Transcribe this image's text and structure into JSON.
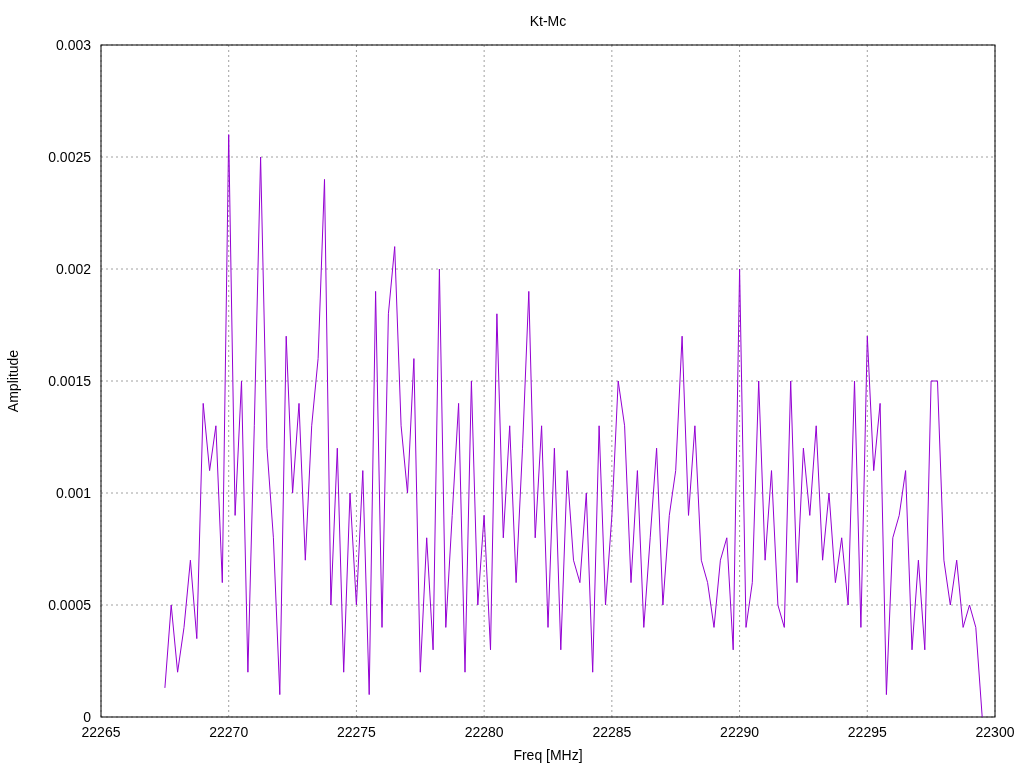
{
  "chart_data": {
    "type": "line",
    "grid": true,
    "title": "Kt-Mc",
    "xlabel": "Freq [MHz]",
    "ylabel": "Amplitude",
    "xlim": [
      22265,
      22300
    ],
    "ylim": [
      0,
      0.003
    ],
    "xticks": [
      {
        "value": 22265,
        "label": "22265"
      },
      {
        "value": 22270,
        "label": "22270"
      },
      {
        "value": 22275,
        "label": "22275"
      },
      {
        "value": 22280,
        "label": "22280"
      },
      {
        "value": 22285,
        "label": "22285"
      },
      {
        "value": 22290,
        "label": "22290"
      },
      {
        "value": 22295,
        "label": "22295"
      },
      {
        "value": 22300,
        "label": "22300"
      }
    ],
    "yticks": [
      {
        "value": 0,
        "label": "0"
      },
      {
        "value": 0.0005,
        "label": "0.0005"
      },
      {
        "value": 0.001,
        "label": "0.001"
      },
      {
        "value": 0.0015,
        "label": "0.0015"
      },
      {
        "value": 0.002,
        "label": "0.002"
      },
      {
        "value": 0.0025,
        "label": "0.0025"
      },
      {
        "value": 0.003,
        "label": "0.003"
      }
    ],
    "x": [
      22267.5,
      22267.75,
      22268,
      22268.25,
      22268.5,
      22268.75,
      22269,
      22269.25,
      22269.5,
      22269.75,
      22270,
      22270.25,
      22270.5,
      22270.75,
      22271,
      22271.25,
      22271.5,
      22271.75,
      22272,
      22272.25,
      22272.5,
      22272.75,
      22273,
      22273.25,
      22273.5,
      22273.75,
      22274,
      22274.25,
      22274.5,
      22274.75,
      22275,
      22275.25,
      22275.5,
      22275.75,
      22276,
      22276.25,
      22276.5,
      22276.75,
      22277,
      22277.25,
      22277.5,
      22277.75,
      22278,
      22278.25,
      22278.5,
      22278.75,
      22279,
      22279.25,
      22279.5,
      22279.75,
      22280,
      22280.25,
      22280.5,
      22280.75,
      22281,
      22281.25,
      22281.5,
      22281.75,
      22282,
      22282.25,
      22282.5,
      22282.75,
      22283,
      22283.25,
      22283.5,
      22283.75,
      22284,
      22284.25,
      22284.5,
      22284.75,
      22285,
      22285.25,
      22285.5,
      22285.75,
      22286,
      22286.25,
      22286.5,
      22286.75,
      22287,
      22287.25,
      22287.5,
      22287.75,
      22288,
      22288.25,
      22288.5,
      22288.75,
      22289,
      22289.25,
      22289.5,
      22289.75,
      22290,
      22290.25,
      22290.5,
      22290.75,
      22291,
      22291.25,
      22291.5,
      22291.75,
      22292,
      22292.25,
      22292.5,
      22292.75,
      22293,
      22293.25,
      22293.5,
      22293.75,
      22294,
      22294.25,
      22294.5,
      22294.75,
      22295,
      22295.25,
      22295.5,
      22295.75,
      22296,
      22296.25,
      22296.5,
      22296.75,
      22297,
      22297.25,
      22297.5,
      22297.75,
      22298,
      22298.25,
      22298.5,
      22298.75,
      22299,
      22299.25,
      22299.5
    ],
    "series": [
      {
        "color": "#9400d3",
        "values": [
          0.00013,
          0.0005,
          0.0002,
          0.0004,
          0.0007,
          0.00035,
          0.0014,
          0.0011,
          0.0013,
          0.0006,
          0.0026,
          0.0009,
          0.0015,
          0.0002,
          0.0013,
          0.0025,
          0.0012,
          0.0008,
          0.0001,
          0.0017,
          0.001,
          0.0014,
          0.0007,
          0.0013,
          0.0016,
          0.0024,
          0.0005,
          0.0012,
          0.0002,
          0.001,
          0.0005,
          0.0011,
          0.0001,
          0.0019,
          0.0004,
          0.0018,
          0.0021,
          0.0013,
          0.001,
          0.0016,
          0.0002,
          0.0008,
          0.0003,
          0.002,
          0.0004,
          0.0009,
          0.0014,
          0.0002,
          0.0015,
          0.0005,
          0.0009,
          0.0003,
          0.0018,
          0.0008,
          0.0013,
          0.0006,
          0.0012,
          0.0019,
          0.0008,
          0.0013,
          0.0004,
          0.0012,
          0.0003,
          0.0011,
          0.0007,
          0.0006,
          0.001,
          0.0002,
          0.0013,
          0.0005,
          0.0009,
          0.0015,
          0.0013,
          0.0006,
          0.0011,
          0.0004,
          0.0008,
          0.0012,
          0.0005,
          0.0009,
          0.0011,
          0.0017,
          0.0009,
          0.0013,
          0.0007,
          0.0006,
          0.0004,
          0.0007,
          0.0008,
          0.0003,
          0.002,
          0.0004,
          0.0006,
          0.0015,
          0.0007,
          0.0011,
          0.0005,
          0.0004,
          0.0015,
          0.0006,
          0.0012,
          0.0009,
          0.0013,
          0.0007,
          0.001,
          0.0006,
          0.0008,
          0.0005,
          0.0015,
          0.0004,
          0.0017,
          0.0011,
          0.0014,
          0.0001,
          0.0008,
          0.0009,
          0.0011,
          0.0003,
          0.0007,
          0.0003,
          0.0015,
          0.0015,
          0.0007,
          0.0005,
          0.0007,
          0.0004,
          0.0005,
          0.0004,
          0
        ]
      }
    ]
  }
}
